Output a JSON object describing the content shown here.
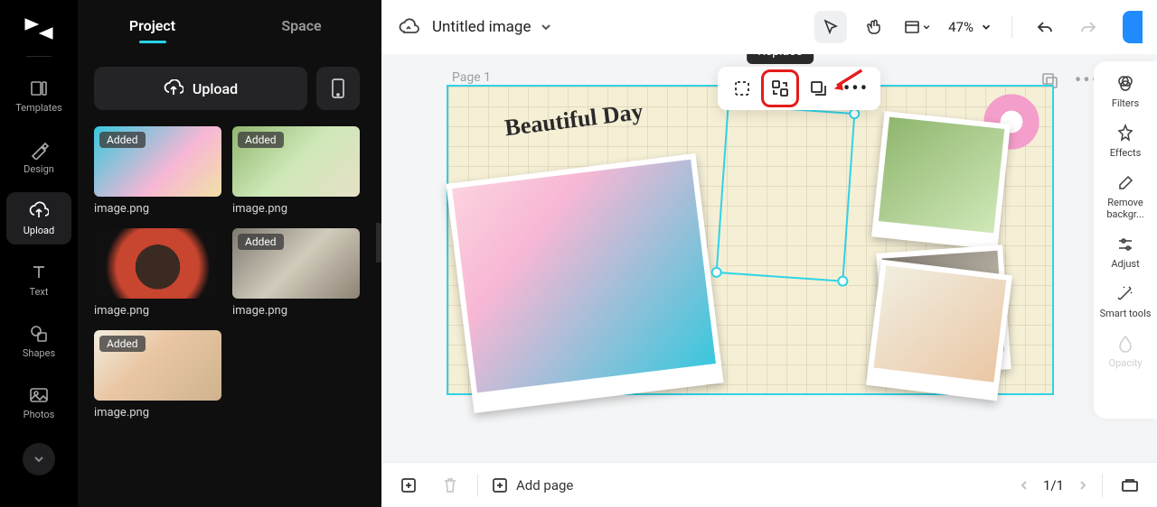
{
  "app": {
    "title": "Untitled image"
  },
  "nav": {
    "items": [
      {
        "label": "Templates"
      },
      {
        "label": "Design"
      },
      {
        "label": "Upload"
      },
      {
        "label": "Text"
      },
      {
        "label": "Shapes"
      },
      {
        "label": "Photos"
      }
    ],
    "active": 2
  },
  "tabs": {
    "project": "Project",
    "space": "Space"
  },
  "upload": {
    "button": "Upload"
  },
  "assets": [
    {
      "name": "image.png",
      "badge": "Added",
      "thumb": "t1"
    },
    {
      "name": "image.png",
      "badge": "Added",
      "thumb": "t2"
    },
    {
      "name": "image.png",
      "badge": null,
      "thumb": "t3"
    },
    {
      "name": "image.png",
      "badge": "Added",
      "thumb": "t4"
    },
    {
      "name": "image.png",
      "badge": "Added",
      "thumb": "t5"
    }
  ],
  "toolbar": {
    "zoom": "47%"
  },
  "page": {
    "label": "Page 1",
    "text_overlay": "Beautiful Day"
  },
  "float_toolbar": {
    "tooltip": "Replace"
  },
  "right_rail": [
    {
      "label": "Filters"
    },
    {
      "label": "Effects"
    },
    {
      "label": "Remove backgr..."
    },
    {
      "label": "Adjust"
    },
    {
      "label": "Smart tools"
    },
    {
      "label": "Opacity"
    }
  ],
  "bottom": {
    "add_page": "Add page",
    "pager": "1/1"
  }
}
